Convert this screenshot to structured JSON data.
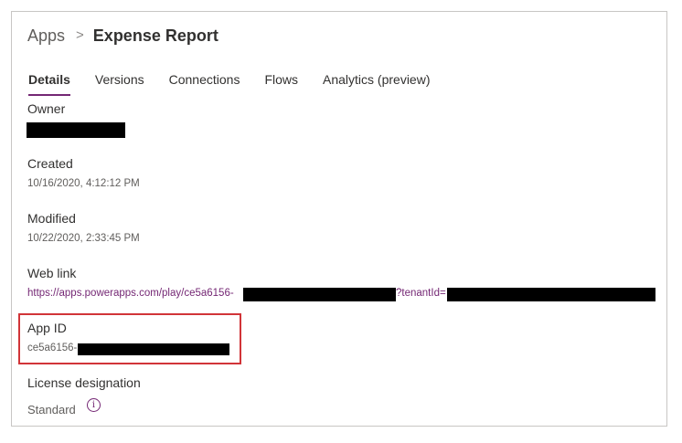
{
  "breadcrumb": {
    "root": "Apps",
    "separator": ">",
    "current": "Expense Report"
  },
  "tabs": [
    {
      "label": "Details",
      "active": true
    },
    {
      "label": "Versions",
      "active": false
    },
    {
      "label": "Connections",
      "active": false
    },
    {
      "label": "Flows",
      "active": false
    },
    {
      "label": "Analytics (preview)",
      "active": false
    }
  ],
  "details": {
    "owner_label": "Owner",
    "created_label": "Created",
    "created_value": "10/16/2020, 4:12:12 PM",
    "modified_label": "Modified",
    "modified_value": "10/22/2020, 2:33:45 PM",
    "weblink_label": "Web link",
    "weblink_prefix": "https://apps.powerapps.com/play/ce5a6156-",
    "weblink_middle": "?tenantId=",
    "appid_label": "App ID",
    "appid_prefix": "ce5a6156-",
    "license_label": "License designation",
    "license_value": "Standard",
    "license_info_icon": "info-icon"
  },
  "colors": {
    "accent": "#742774",
    "highlight_border": "#d13438",
    "redaction": "#000000"
  }
}
